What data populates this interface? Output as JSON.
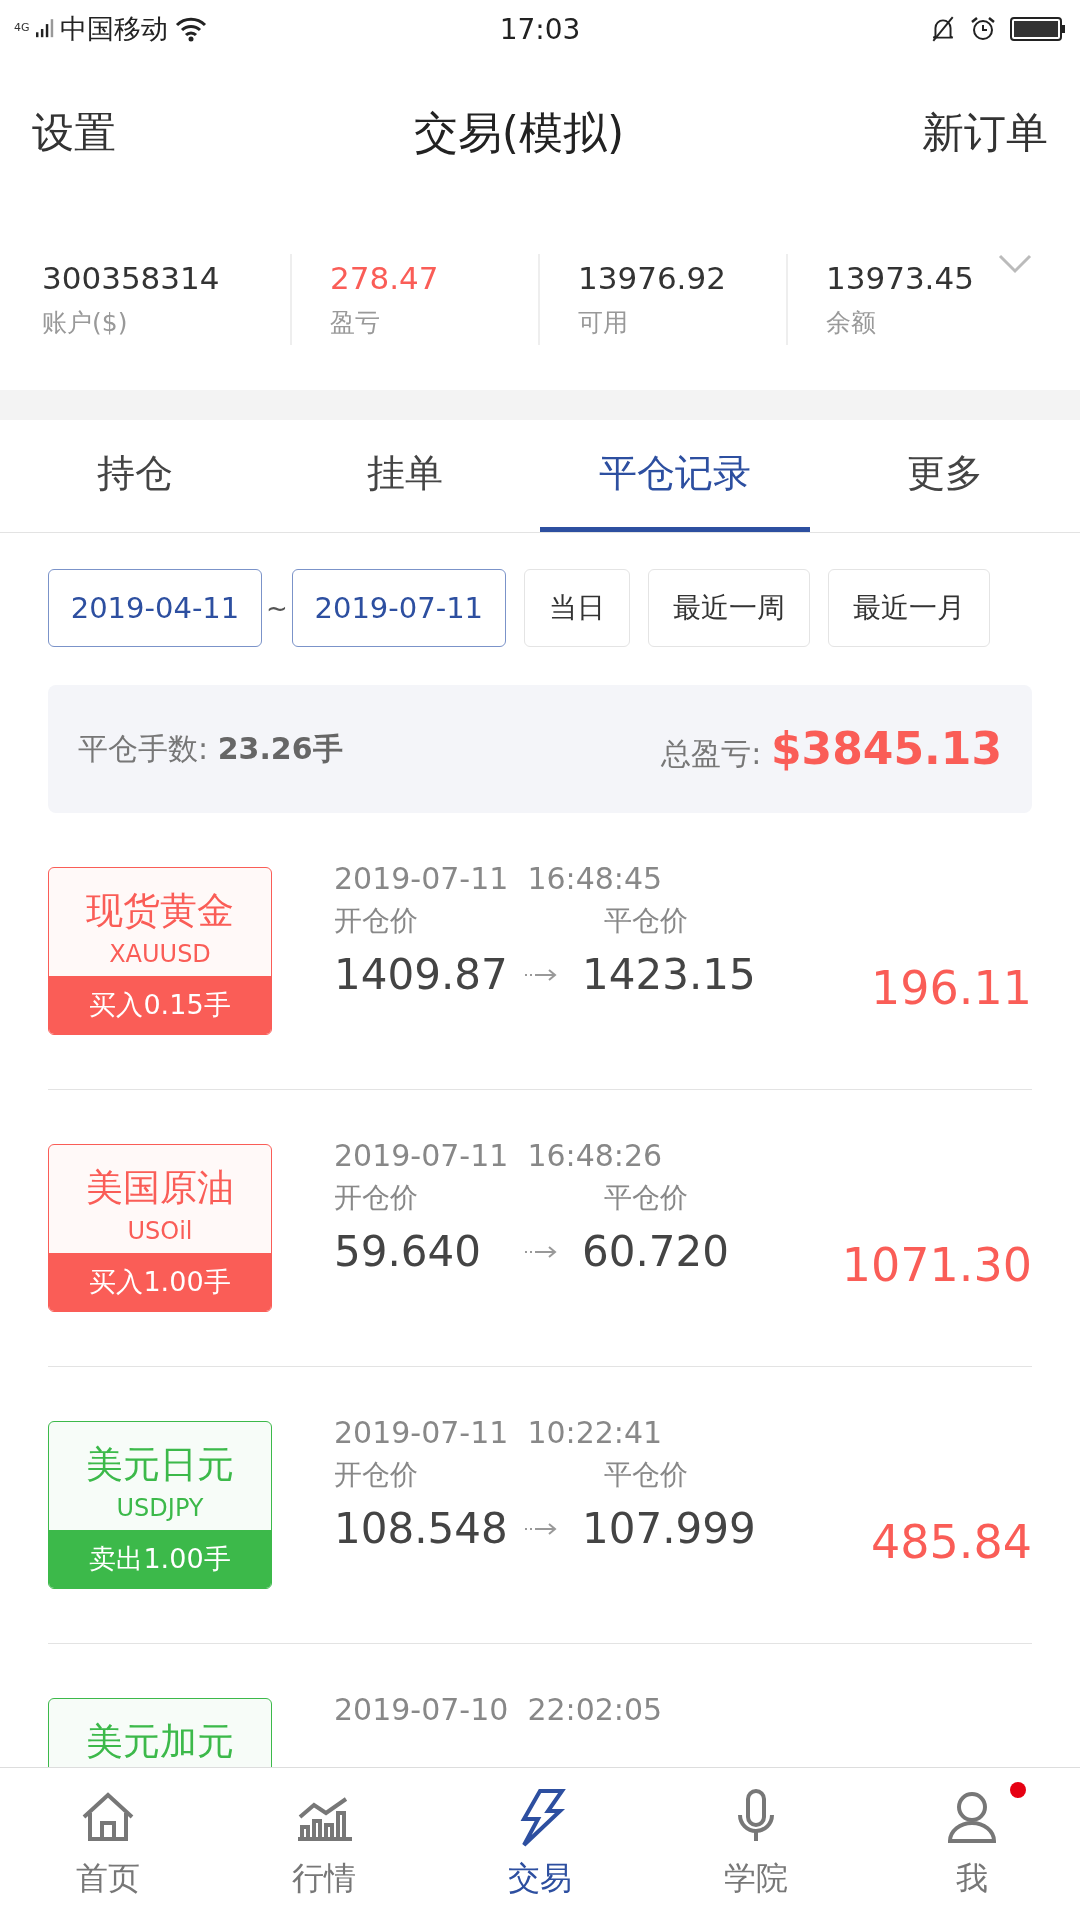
{
  "status_bar": {
    "network": "4G",
    "carrier": "中国移动",
    "time": "17:03"
  },
  "header": {
    "left": "设置",
    "title": "交易(模拟)",
    "right": "新订单"
  },
  "account": [
    {
      "value": "300358314",
      "label": "账户($)",
      "highlight": false
    },
    {
      "value": "278.47",
      "label": "盈亏",
      "highlight": true
    },
    {
      "value": "13976.92",
      "label": "可用",
      "highlight": false
    },
    {
      "value": "13973.45",
      "label": "余额",
      "highlight": false
    }
  ],
  "tabs": [
    {
      "label": "持仓",
      "selected": false
    },
    {
      "label": "挂单",
      "selected": false
    },
    {
      "label": "平仓记录",
      "selected": true
    },
    {
      "label": "更多",
      "selected": false
    }
  ],
  "date_range": {
    "from": "2019-04-11",
    "separator": "~",
    "to": "2019-07-11"
  },
  "quick_ranges": [
    "当日",
    "最近一周",
    "最近一月"
  ],
  "summary": {
    "lots_label": "平仓手数:",
    "lots": "23.26手",
    "pnl_label": "总盈亏:",
    "pnl": "$3845.13"
  },
  "records": [
    {
      "name": "现货黄金",
      "symbol": "XAUUSD",
      "kind": "buy",
      "order": "买入0.15手",
      "time": "2019-07-11  16:48:45",
      "open_label": "开仓价",
      "close_label": "平仓价",
      "open": "1409.87",
      "close": "1423.15",
      "pnl": "196.11"
    },
    {
      "name": "美国原油",
      "symbol": "USOil",
      "kind": "buy",
      "order": "买入1.00手",
      "time": "2019-07-11  16:48:26",
      "open_label": "开仓价",
      "close_label": "平仓价",
      "open": "59.640",
      "close": "60.720",
      "pnl": "1071.30"
    },
    {
      "name": "美元日元",
      "symbol": "USDJPY",
      "kind": "sell",
      "order": "卖出1.00手",
      "time": "2019-07-11  10:22:41",
      "open_label": "开仓价",
      "close_label": "平仓价",
      "open": "108.548",
      "close": "107.999",
      "pnl": "485.84"
    },
    {
      "name": "美元加元",
      "kind": "sell",
      "time": "2019-07-10  22:02:05"
    }
  ],
  "nav": [
    {
      "label": "首页",
      "kind": "home",
      "selected": false,
      "badge": false
    },
    {
      "label": "行情",
      "kind": "chart",
      "selected": false,
      "badge": false
    },
    {
      "label": "交易",
      "kind": "bolt",
      "selected": true,
      "badge": false
    },
    {
      "label": "学院",
      "kind": "mic",
      "selected": false,
      "badge": false
    },
    {
      "label": "我",
      "kind": "user",
      "selected": false,
      "badge": true
    }
  ]
}
